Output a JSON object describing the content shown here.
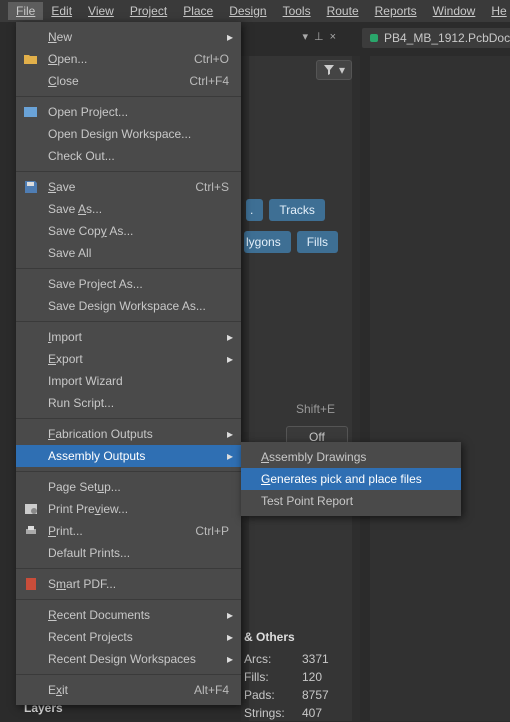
{
  "menubar": {
    "file": "File",
    "edit": "Edit",
    "view": "View",
    "project": "Project",
    "place": "Place",
    "design": "Design",
    "tools": "Tools",
    "route": "Route",
    "reports": "Reports",
    "window": "Window",
    "help": "He"
  },
  "tab": {
    "label": "PB4_MB_1912.PcbDoc"
  },
  "toolbar": {
    "pin_chars": {
      "down": "▾",
      "tack": "⊥",
      "x": "×"
    }
  },
  "tags": {
    "tracks": "Tracks",
    "polygons": "lygons",
    "fills": "Fills"
  },
  "selection": {
    "shift_e": "Shift+E",
    "off": "Off"
  },
  "file_menu": {
    "new": {
      "label": "New",
      "hot": "N"
    },
    "open": {
      "label": "Open...",
      "hot": "O",
      "shortcut": "Ctrl+O"
    },
    "close": {
      "label": "Close",
      "hot": "C",
      "shortcut": "Ctrl+F4"
    },
    "open_project": {
      "label": "Open Project...",
      "hot": ""
    },
    "open_workspace": {
      "label": "Open Design Workspace...",
      "hot": ""
    },
    "check_out": {
      "label": "Check Out...",
      "hot": ""
    },
    "save": {
      "label": "Save",
      "hot": "S",
      "shortcut": "Ctrl+S"
    },
    "save_as": {
      "label": "Save As...",
      "hot": "A"
    },
    "save_copy_as": {
      "label": "Save Copy As...",
      "hot": "y"
    },
    "save_all": {
      "label": "Save All",
      "hot": ""
    },
    "save_project_as": {
      "label": "Save Project As...",
      "hot": ""
    },
    "save_workspace_as": {
      "label": "Save Design Workspace As...",
      "hot": ""
    },
    "import": {
      "label": "Import",
      "hot": "I"
    },
    "export": {
      "label": "Export",
      "hot": "E"
    },
    "import_wizard": {
      "label": "Import Wizard",
      "hot": ""
    },
    "run_script": {
      "label": "Run Script...",
      "hot": ""
    },
    "fabrication_outputs": {
      "label": "Fabrication Outputs",
      "hot": "F"
    },
    "assembly_outputs": {
      "label": "Assembly Outputs",
      "hot": ""
    },
    "page_setup": {
      "label": "Page Setup...",
      "hot": "u"
    },
    "print_preview": {
      "label": "Print Preview...",
      "hot": "v"
    },
    "print": {
      "label": "Print...",
      "hot": "P",
      "shortcut": "Ctrl+P"
    },
    "default_prints": {
      "label": "Default Prints...",
      "hot": ""
    },
    "smart_pdf": {
      "label": "Smart PDF...",
      "hot": "m"
    },
    "recent_documents": {
      "label": "Recent Documents",
      "hot": "R"
    },
    "recent_projects": {
      "label": "Recent Projects",
      "hot": ""
    },
    "recent_workspaces": {
      "label": "Recent Design Workspaces",
      "hot": ""
    },
    "exit": {
      "label": "Exit",
      "hot": "x",
      "shortcut": "Alt+F4"
    }
  },
  "submenu": {
    "assembly_drawings": {
      "label": "Assembly Drawings",
      "hot": "A"
    },
    "pick_place": {
      "label": "Generates pick and place files",
      "hot": "G"
    },
    "test_point": {
      "label": "Test Point Report",
      "hot": ""
    }
  },
  "stats": {
    "title": "& Others",
    "arcs_label": "Arcs:",
    "arcs": "3371",
    "fills_label": "Fills:",
    "fills": "120",
    "pads_label": "Pads:",
    "pads": "8757",
    "strings_label": "Strings:",
    "strings": "407"
  },
  "footer": {
    "layers": "Layers"
  }
}
